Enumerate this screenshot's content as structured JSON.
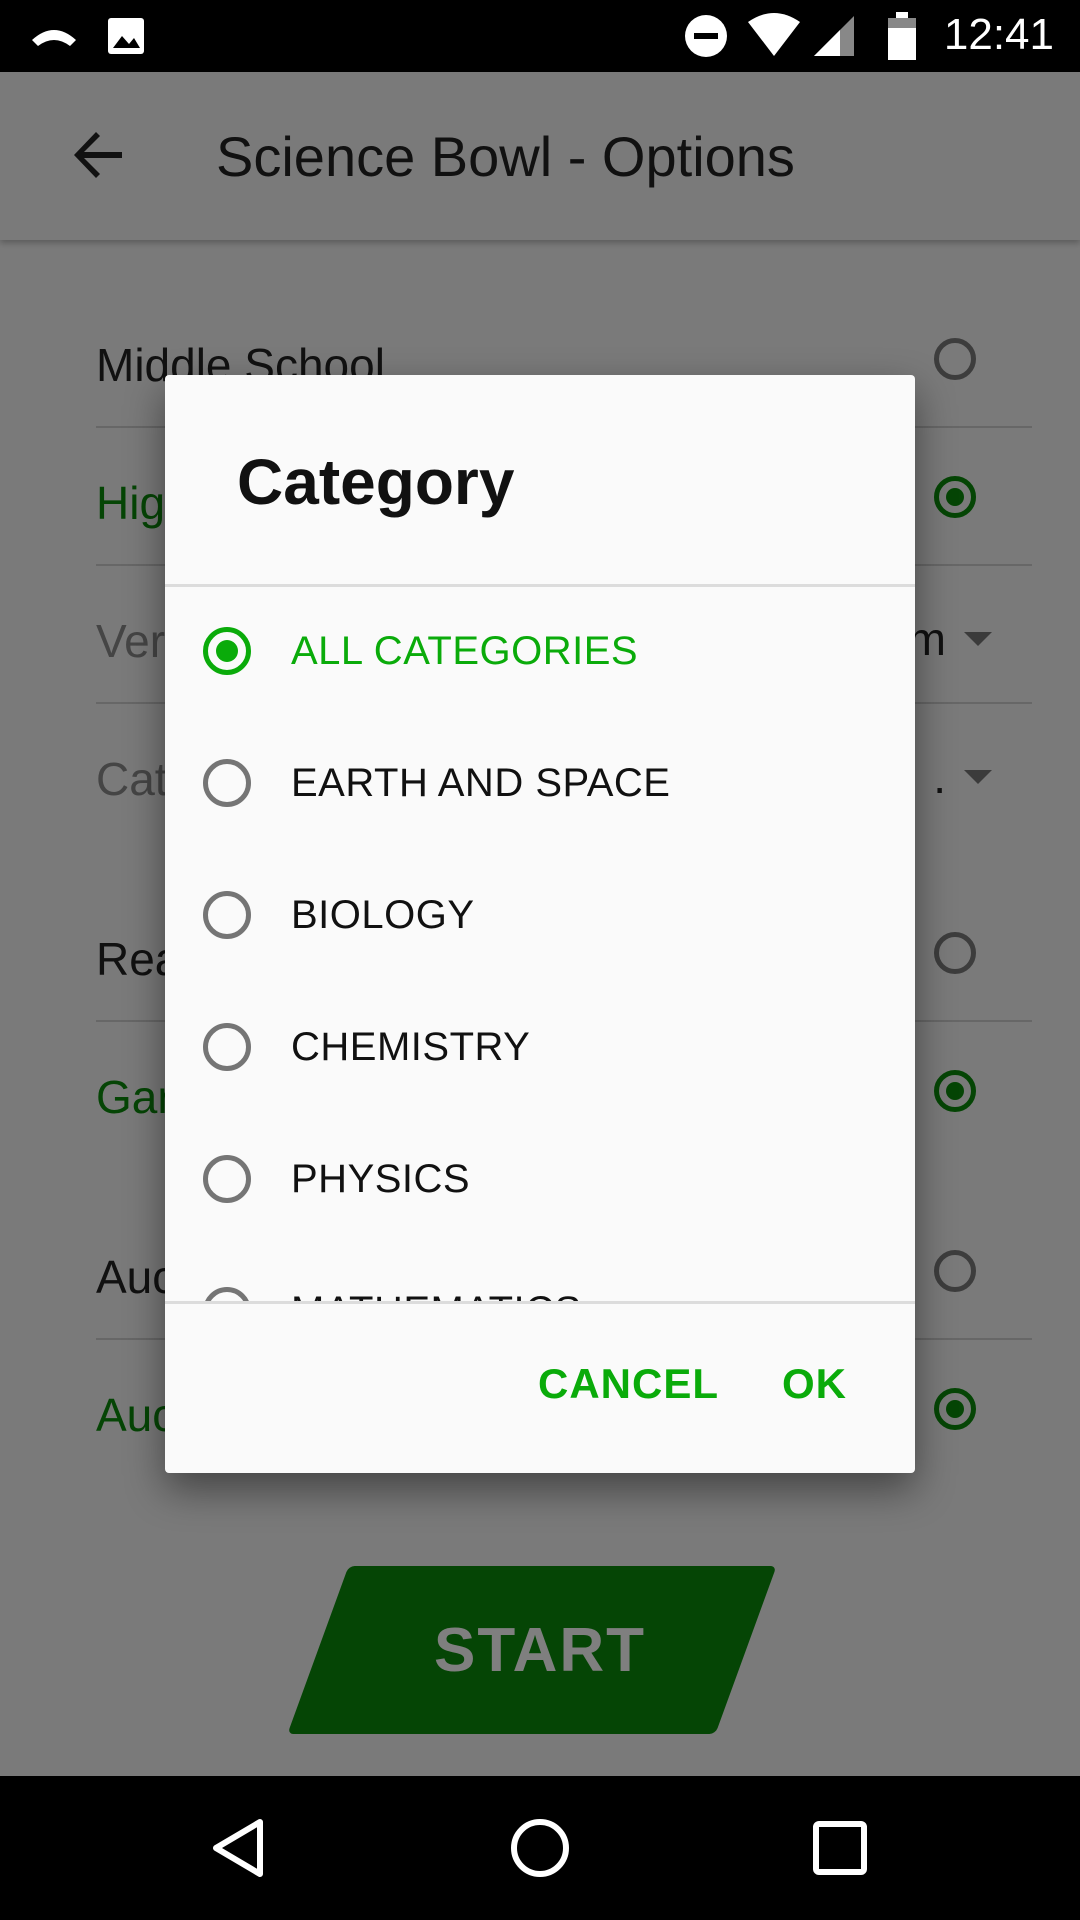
{
  "status_bar": {
    "time": "12:41",
    "icons": [
      "missed-call-icon",
      "image-icon",
      "do-not-disturb-icon",
      "wifi-icon",
      "signal-icon",
      "battery-icon"
    ]
  },
  "app_bar": {
    "title": "Science Bowl - Options",
    "back_icon": "arrow-back-icon"
  },
  "background": {
    "rows": [
      {
        "label": "Middle School",
        "selected": false
      },
      {
        "label": "Hig",
        "selected": true
      },
      {
        "label": "Ver",
        "value": "m"
      },
      {
        "label": "Cat",
        "value": "."
      },
      {
        "label": "Rea",
        "selected": false
      },
      {
        "label": "Gar",
        "selected": true
      },
      {
        "label": "Auc",
        "selected": false
      },
      {
        "label": "Auc",
        "selected": true
      }
    ],
    "start_label": "START"
  },
  "dialog": {
    "title": "Category",
    "options": [
      {
        "label": "ALL CATEGORIES",
        "selected": true
      },
      {
        "label": "EARTH AND SPACE",
        "selected": false
      },
      {
        "label": "BIOLOGY",
        "selected": false
      },
      {
        "label": "CHEMISTRY",
        "selected": false
      },
      {
        "label": "PHYSICS",
        "selected": false
      },
      {
        "label": "MATHEMATICS",
        "selected": false
      }
    ],
    "cancel_label": "CANCEL",
    "ok_label": "OK"
  },
  "colors": {
    "accent": "#0aab0a",
    "accent_dark": "#0a8a0a",
    "scrim": "rgba(0,0,0,0.5)",
    "status_bar": "#000000"
  },
  "nav_bar": {
    "icons": [
      "back-triangle-icon",
      "home-circle-icon",
      "recents-square-icon"
    ]
  }
}
